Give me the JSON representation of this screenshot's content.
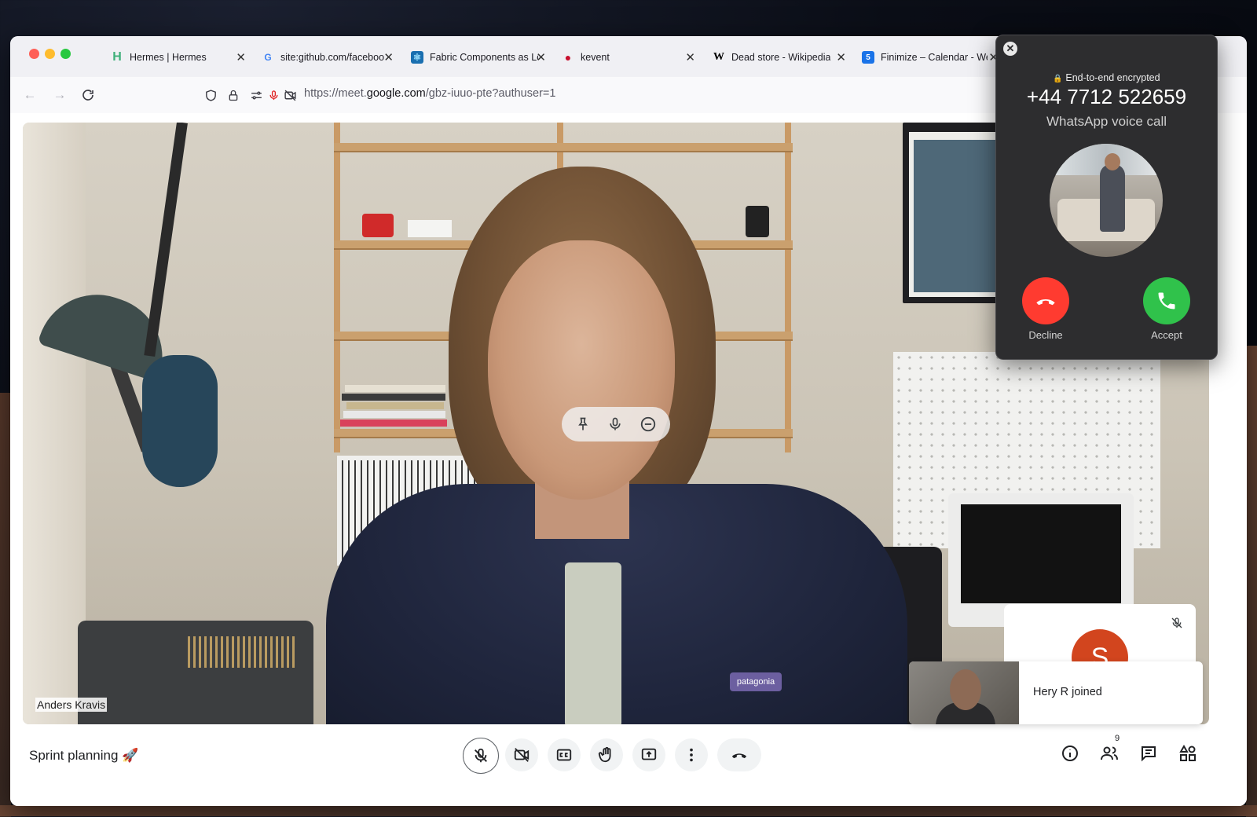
{
  "browser": {
    "tabs": [
      {
        "title": "Hermes | Hermes",
        "favicon": "H",
        "favicon_color": "#3fb07a"
      },
      {
        "title": "site:github.com/faceboo",
        "favicon": "G",
        "favicon_color": "#4285f4"
      },
      {
        "title": "Fabric Components as Le",
        "favicon": "⚛",
        "favicon_color": "#1a6fb0"
      },
      {
        "title": "kevent",
        "favicon": "●",
        "favicon_color": "#c8102e"
      },
      {
        "title": "Dead store - Wikipedia",
        "favicon": "W",
        "favicon_color": "#000000"
      },
      {
        "title": "Finimize – Calendar - We",
        "favicon": "5",
        "favicon_color": "#1a73e8"
      }
    ],
    "url_prefix": "https://meet.",
    "url_domain": "google.com",
    "url_path": "/gbz-iuuo-pte?authuser=1"
  },
  "meet": {
    "speaker_name": "Anders Kravis",
    "meeting_title": "Sprint planning 🚀",
    "self_avatar_letter": "S",
    "toast_text": "Hery R joined",
    "people_count": "9",
    "jacket_logo": "patagonia"
  },
  "call": {
    "encryption": "End-to-end encrypted",
    "number": "+44 7712 522659",
    "type": "WhatsApp voice call",
    "decline_label": "Decline",
    "accept_label": "Accept"
  }
}
